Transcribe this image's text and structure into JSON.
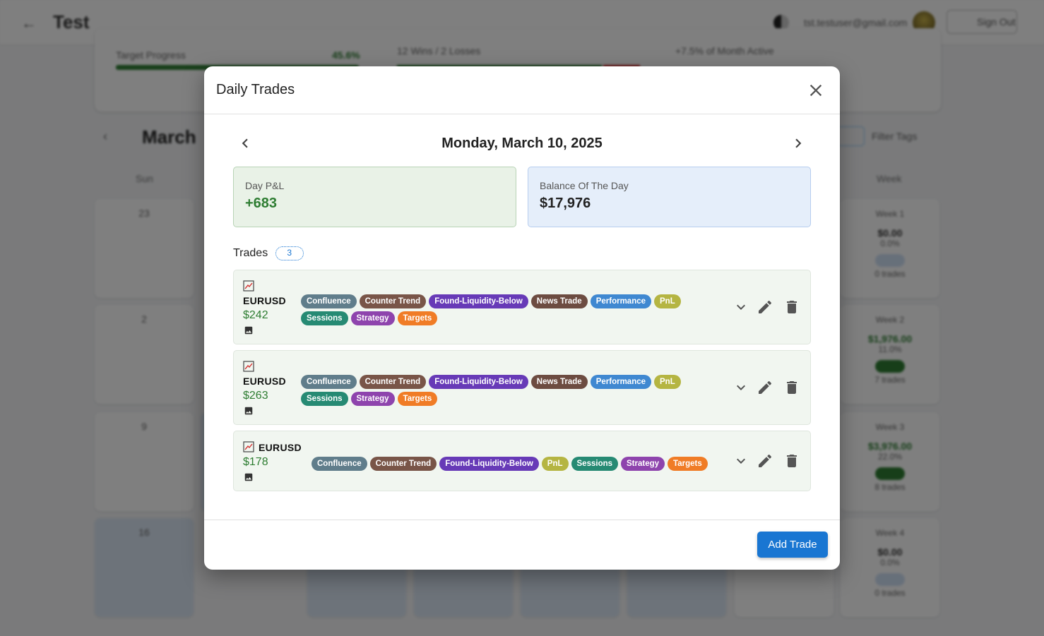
{
  "background": {
    "app_title": "Test",
    "email": "tst.testuser@gmail.com",
    "signout_label": "Sign Out",
    "target_label": "Target Progress",
    "target_pct": "45.6%",
    "winloss_text": "12 Wins / 2 Losses",
    "monthly_text": "+7.5% of Month Active",
    "month_title": "March",
    "filter_label": "Filter Tags",
    "sun_label": "Sun",
    "week_label": "Week",
    "week_summaries": [
      {
        "label": "Week 1",
        "amount": "$0.00",
        "pct": "0.0%",
        "trades": "0 trades"
      },
      {
        "label": "Week 2",
        "amount": "$1,976.00",
        "pct": "11.0%",
        "trades": "7 trades"
      },
      {
        "label": "Week 3",
        "amount": "$3,976.00",
        "pct": "22.0%",
        "trades": "8 trades"
      },
      {
        "label": "Week 4",
        "amount": "$0.00",
        "pct": "0.0%",
        "trades": "0 trades"
      }
    ]
  },
  "modal": {
    "title": "Daily Trades",
    "date": "Monday, March 10, 2025",
    "day_pnl_label": "Day P&L",
    "day_pnl_value": "+683",
    "balance_label": "Balance Of The Day",
    "balance_value": "$17,976",
    "trades_label": "Trades",
    "trades_count": "3",
    "add_trade_label": "Add Trade",
    "trades": [
      {
        "symbol": "EURUSD",
        "pnl": "$242",
        "tags": [
          "Confluence",
          "Counter Trend",
          "Found-Liquidity-Below",
          "News Trade",
          "Performance",
          "PnL",
          "Sessions",
          "Strategy",
          "Targets"
        ]
      },
      {
        "symbol": "EURUSD",
        "pnl": "$263",
        "tags": [
          "Confluence",
          "Counter Trend",
          "Found-Liquidity-Below",
          "News Trade",
          "Performance",
          "PnL",
          "Sessions",
          "Strategy",
          "Targets"
        ]
      },
      {
        "symbol": "EURUSD",
        "pnl": "$178",
        "tags": [
          "Confluence",
          "Counter Trend",
          "Found-Liquidity-Below",
          "PnL",
          "Sessions",
          "Strategy",
          "Targets"
        ]
      }
    ]
  },
  "tag_colors": {
    "Confluence": "#607d8b",
    "Counter Trend": "#795548",
    "Found-Liquidity-Below": "#673ab7",
    "News Trade": "#6d4c41",
    "Performance": "#3f88d1",
    "PnL": "#b5b542",
    "Sessions": "#268a73",
    "Strategy": "#8e44ad",
    "Targets": "#f07c26"
  },
  "colors": {
    "accent": "#1976d2",
    "profit": "#2e7d32"
  }
}
